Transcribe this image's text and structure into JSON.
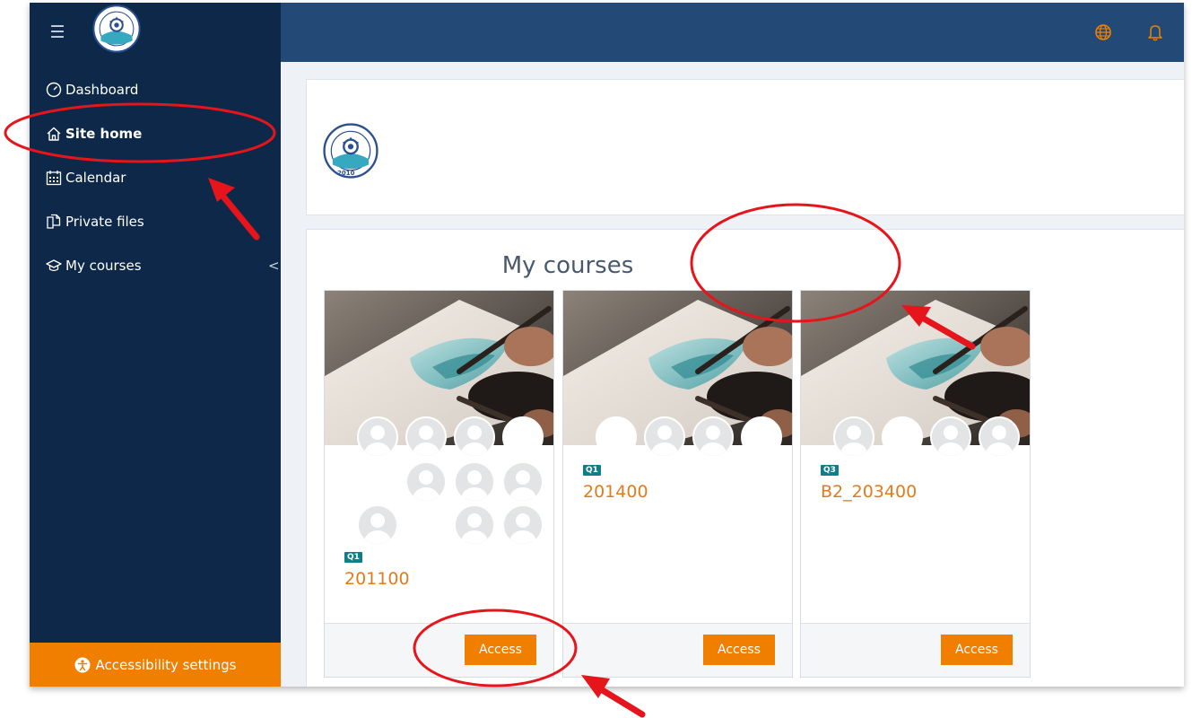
{
  "header": {
    "menu_icon": "hamburger-icon",
    "language_icon": "globe-icon",
    "notifications_icon": "bell-icon"
  },
  "sidebar": {
    "items": [
      {
        "label": "Dashboard",
        "icon": "dashboard-icon"
      },
      {
        "label": "Site home",
        "icon": "home-icon"
      },
      {
        "label": "Calendar",
        "icon": "calendar-icon"
      },
      {
        "label": "Private files",
        "icon": "files-icon"
      },
      {
        "label": "My courses",
        "icon": "graduation-cap-icon",
        "chevron": "<"
      }
    ],
    "accessibility_label": "Accessibility settings"
  },
  "main": {
    "logo_year": "2010",
    "section_title": "My courses",
    "courses": [
      {
        "badge": "Q1",
        "name": "201100",
        "button": "Access"
      },
      {
        "badge": "Q1",
        "name": "201400",
        "button": "Access"
      },
      {
        "badge": "Q3",
        "name": "B2_203400",
        "button": "Access"
      }
    ]
  },
  "colors": {
    "sidebar": "#0d2848",
    "topbar": "#234a76",
    "accent": "#f07f00",
    "course_link": "#e37b1d",
    "badge": "#0f7e8a",
    "annotation": "#e6141b"
  }
}
